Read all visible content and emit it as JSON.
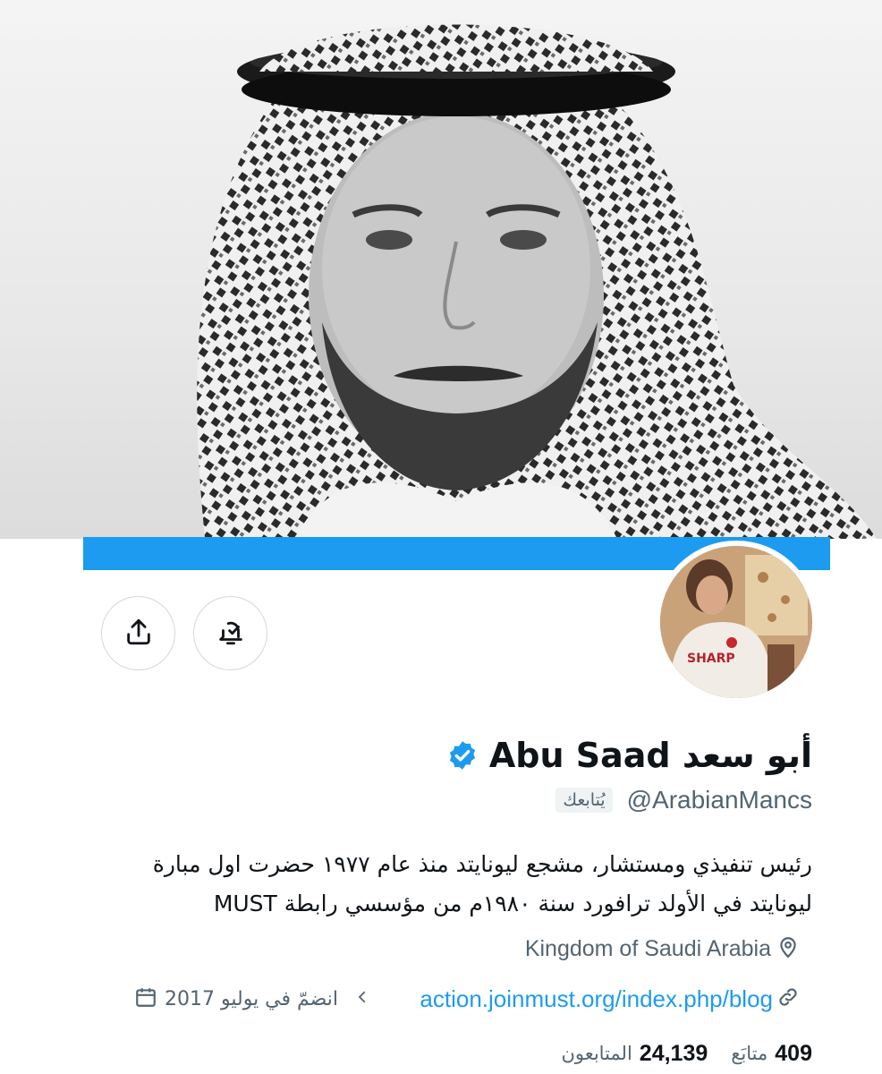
{
  "profile": {
    "display_name": "أبو سعد Abu Saad",
    "handle": "@ArabianMancs",
    "follows_you_label": "يُتابعك",
    "bio": "رئيس تنفيذي ومستشار، مشجع ليونايتد منذ عام ١٩٧٧ حضرت اول مبارة ليونايتد في الأولد ترافورد سنة ١٩٨٠م من مؤسسي رابطة MUST",
    "location": "Kingdom of Saudi Arabia",
    "website": "action.joinmust.org/index.php/blog",
    "joined": "انضمّ في يوليو 2017",
    "verified": true
  },
  "stats": {
    "following_count": "409",
    "following_label": "متابَع",
    "followers_count": "24,139",
    "followers_label": "المتابعون"
  },
  "icons": {
    "share": "share-icon",
    "notifications": "bell-check-icon",
    "verified": "verified-badge-icon",
    "location": "location-pin-icon",
    "link": "link-icon",
    "calendar": "calendar-icon",
    "chevron": "chevron-left-icon"
  },
  "colors": {
    "accent": "#1d9bf0",
    "text_primary": "#0f1419",
    "text_secondary": "#536471",
    "border": "#cfd9de"
  }
}
